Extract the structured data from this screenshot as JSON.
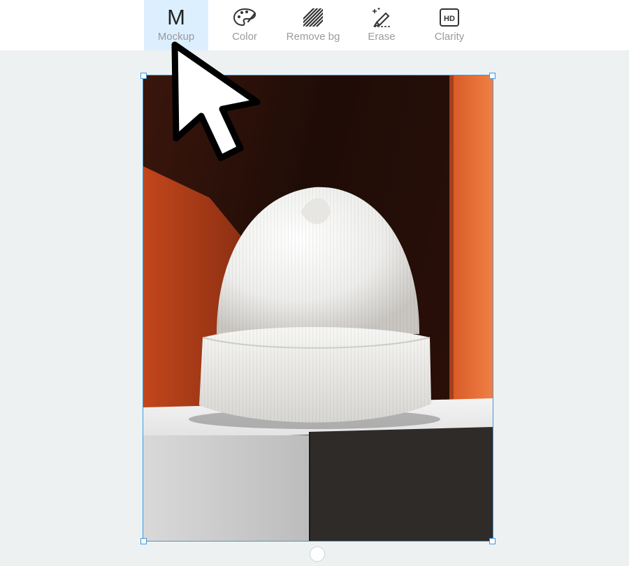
{
  "toolbar": {
    "tools": [
      {
        "label": "Mockup",
        "glyph": "M",
        "icon": "mockup-icon",
        "active": true
      },
      {
        "label": "Color",
        "icon": "palette-icon",
        "active": false
      },
      {
        "label": "Remove bg",
        "icon": "remove-bg-icon",
        "active": false
      },
      {
        "label": "Erase",
        "icon": "erase-icon",
        "active": false
      },
      {
        "label": "Clarity",
        "glyph": "HD",
        "icon": "hd-icon",
        "active": false
      }
    ]
  },
  "canvas": {
    "image": "photo-white-beanie-on-pedestal",
    "selection_color": "#3f98e0"
  },
  "colors": {
    "active_tool_bg": "#dcefff",
    "canvas_bg": "#edf1f2",
    "label": "#9a9a9a"
  }
}
